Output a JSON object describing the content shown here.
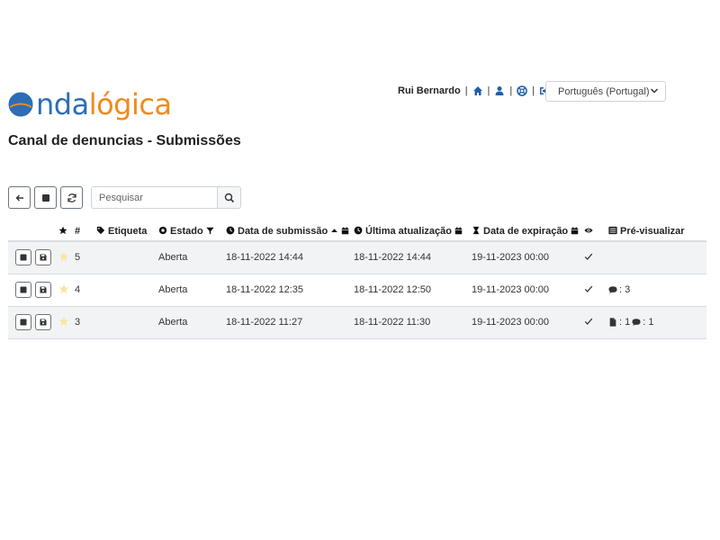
{
  "logo": {
    "part_a": "nda",
    "part_b": "lógica"
  },
  "user": {
    "name": "Rui Bernardo",
    "sep": "|"
  },
  "language": {
    "selected": "Português (Portugal)"
  },
  "page": {
    "title": "Canal de denuncias - Submissões"
  },
  "search": {
    "placeholder": "Pesquisar",
    "value": ""
  },
  "table": {
    "headers": {
      "hash": "#",
      "label": "Etiqueta",
      "status": "Estado",
      "submission_date": "Data de submissão",
      "last_update": "Última atualização",
      "expiration": "Data de expiração",
      "preview": "Pré-visualizar"
    },
    "rows": [
      {
        "id": "5",
        "status": "Aberta",
        "submitted": "18-11-2022 14:44",
        "updated": "18-11-2022 14:44",
        "expires": "19-11-2023 00:00",
        "files": "",
        "comments": ""
      },
      {
        "id": "4",
        "status": "Aberta",
        "submitted": "18-11-2022 12:35",
        "updated": "18-11-2022 12:50",
        "expires": "19-11-2023 00:00",
        "files": "",
        "comments": ": 3"
      },
      {
        "id": "3",
        "status": "Aberta",
        "submitted": "18-11-2022 11:27",
        "updated": "18-11-2022 11:30",
        "expires": "19-11-2023 00:00",
        "files": ": 1",
        "comments": ": 1"
      }
    ]
  },
  "colors": {
    "brand_blue": "#2d6db6",
    "brand_orange": "#f08a1c",
    "star_empty": "#f7e6a6"
  },
  "icons": [
    "home-icon",
    "user-icon",
    "help-icon",
    "logout-icon",
    "back-arrow-icon",
    "stop-icon",
    "refresh-icon",
    "search-icon",
    "star-icon",
    "tag-icon",
    "circle-icon",
    "filter-icon",
    "clock-icon",
    "calendar-icon",
    "hourglass-icon",
    "eye-icon",
    "list-icon",
    "save-icon",
    "check-icon",
    "comment-icon",
    "file-icon"
  ]
}
